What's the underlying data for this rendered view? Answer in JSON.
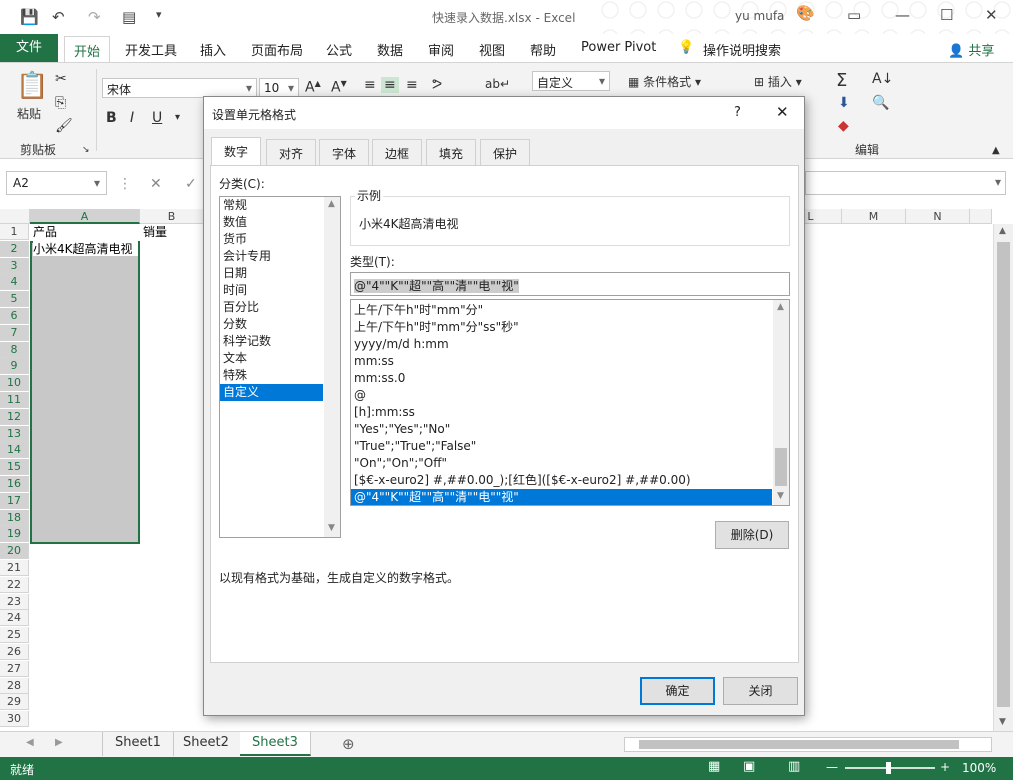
{
  "title_bar": {
    "file_name": "快速录入数据.xlsx",
    "separator": "-",
    "app": "Excel",
    "user": "yu mufa"
  },
  "ribbon_tabs": [
    "文件",
    "开始",
    "开发工具",
    "插入",
    "页面布局",
    "公式",
    "数据",
    "审阅",
    "视图",
    "帮助",
    "Power Pivot",
    "操作说明搜索"
  ],
  "share_label": "共享",
  "ribbon": {
    "paste_label": "粘贴",
    "clipboard_group": "剪贴板",
    "font_name": "宋体",
    "font_size": "10",
    "number_format": "自定义",
    "conditional_format": "条件格式",
    "insert_label": "插入",
    "editing_group": "编辑"
  },
  "name_box": "A2",
  "grid": {
    "columns": [
      "A",
      "B",
      "L",
      "M",
      "N"
    ],
    "rows": [
      "1",
      "2",
      "3",
      "4",
      "5",
      "6",
      "7",
      "8",
      "9",
      "10",
      "11",
      "12",
      "13",
      "14",
      "15",
      "16",
      "17",
      "18",
      "19",
      "20",
      "21",
      "22",
      "23",
      "24",
      "25",
      "26",
      "27",
      "28",
      "29",
      "30"
    ],
    "a1": "产品",
    "b1": "销量",
    "a2": "小米4K超高清电视"
  },
  "sheet_tabs": [
    "Sheet1",
    "Sheet2",
    "Sheet3"
  ],
  "active_sheet": "Sheet3",
  "status": {
    "ready": "就绪",
    "zoom": "100%"
  },
  "dialog": {
    "title": "设置单元格格式",
    "help": "?",
    "tabs": [
      "数字",
      "对齐",
      "字体",
      "边框",
      "填充",
      "保护"
    ],
    "category_label": "分类(C):",
    "categories": [
      "常规",
      "数值",
      "货币",
      "会计专用",
      "日期",
      "时间",
      "百分比",
      "分数",
      "科学记数",
      "文本",
      "特殊",
      "自定义"
    ],
    "selected_category": "自定义",
    "sample_label": "示例",
    "sample_value": "小米4K超高清电视",
    "type_label": "类型(T):",
    "type_value": "@\"4\"\"K\"\"超\"\"高\"\"清\"\"电\"\"视\"",
    "type_list": [
      "上午/下午h\"时\"mm\"分\"",
      "上午/下午h\"时\"mm\"分\"ss\"秒\"",
      "yyyy/m/d h:mm",
      "mm:ss",
      "mm:ss.0",
      "@",
      "[h]:mm:ss",
      "\"Yes\";\"Yes\";\"No\"",
      "\"True\";\"True\";\"False\"",
      "\"On\";\"On\";\"Off\"",
      "[$€-x-euro2] #,##0.00_);[红色]([$€-x-euro2] #,##0.00)",
      "@\"4\"\"K\"\"超\"\"高\"\"清\"\"电\"\"视\""
    ],
    "delete_button": "删除(D)",
    "description": "以现有格式为基础，生成自定义的数字格式。",
    "ok_button": "确定",
    "close_button": "关闭"
  },
  "colors": {
    "excel_green": "#217346",
    "selection_blue": "#0078d7"
  }
}
